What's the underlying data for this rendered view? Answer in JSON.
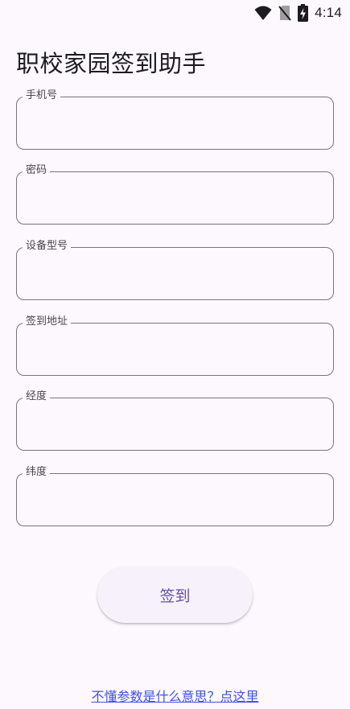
{
  "status_bar": {
    "time": "4:14",
    "icons": [
      "wifi-icon",
      "no-sim-icon",
      "battery-charging-icon"
    ]
  },
  "page_title": "职校家园签到助手",
  "fields": [
    {
      "label": "手机号",
      "value": "",
      "placeholder": ""
    },
    {
      "label": "密码",
      "value": "",
      "placeholder": ""
    },
    {
      "label": "设备型号",
      "value": "",
      "placeholder": ""
    },
    {
      "label": "签到地址",
      "value": "",
      "placeholder": ""
    },
    {
      "label": "经度",
      "value": "",
      "placeholder": ""
    },
    {
      "label": "纬度",
      "value": "",
      "placeholder": ""
    }
  ],
  "checkin_button_label": "签到",
  "help_link_text": "不懂参数是什么意思？点这里",
  "colors": {
    "background": "#fdf8fd",
    "outline": "#79747e",
    "button_text": "#6750a4",
    "button_bg": "#f6f1fb",
    "link": "#3f51e8"
  }
}
